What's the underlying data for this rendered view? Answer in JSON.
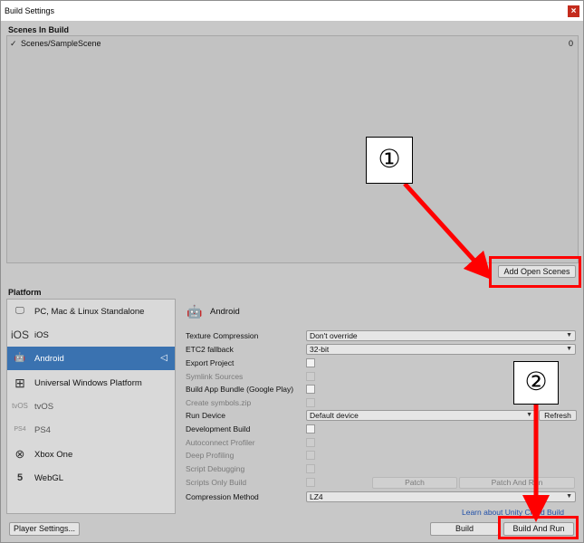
{
  "window": {
    "title": "Build Settings",
    "close_glyph": "×"
  },
  "scenes": {
    "header": "Scenes In Build",
    "items": [
      {
        "checked": true,
        "check_glyph": "✓",
        "name": "Scenes/SampleScene",
        "index": "0"
      }
    ],
    "add_open_scenes_label": "Add Open Scenes"
  },
  "platform": {
    "header": "Platform",
    "items": [
      {
        "label": "PC, Mac & Linux Standalone",
        "icon": "monitor-icon",
        "glyph": "🖵",
        "selected": false,
        "dim": false
      },
      {
        "label": "iOS",
        "icon": "ios-icon",
        "glyph": "iOS",
        "selected": false,
        "dim": false
      },
      {
        "label": "Android",
        "icon": "android-icon",
        "glyph": "🤖",
        "selected": true,
        "dim": false
      },
      {
        "label": "Universal Windows Platform",
        "icon": "windows-icon",
        "glyph": "⊞",
        "selected": false,
        "dim": false
      },
      {
        "label": "tvOS",
        "icon": "tvos-icon",
        "glyph": "tvOS",
        "selected": false,
        "dim": true
      },
      {
        "label": "PS4",
        "icon": "ps4-icon",
        "glyph": "PS4",
        "selected": false,
        "dim": true
      },
      {
        "label": "Xbox One",
        "icon": "xbox-icon",
        "glyph": "⊗",
        "selected": false,
        "dim": false
      },
      {
        "label": "WebGL",
        "icon": "html5-icon",
        "glyph": "5",
        "selected": false,
        "dim": false
      }
    ],
    "unity_badge_glyph": "◁"
  },
  "settings": {
    "title": "Android",
    "title_icon_glyph": "🤖",
    "texture_compression": {
      "label": "Texture Compression",
      "value": "Don't override"
    },
    "etc2_fallback": {
      "label": "ETC2 fallback",
      "value": "32-bit"
    },
    "export_project": {
      "label": "Export Project"
    },
    "symlink_sources": {
      "label": "Symlink Sources"
    },
    "build_app_bundle": {
      "label": "Build App Bundle (Google Play)"
    },
    "create_symbols": {
      "label": "Create symbols.zip"
    },
    "run_device": {
      "label": "Run Device",
      "value": "Default device",
      "refresh_label": "Refresh"
    },
    "development_build": {
      "label": "Development Build"
    },
    "autoconnect_profiler": {
      "label": "Autoconnect Profiler"
    },
    "deep_profiling": {
      "label": "Deep Profiling"
    },
    "script_debugging": {
      "label": "Script Debugging"
    },
    "scripts_only_build": {
      "label": "Scripts Only Build",
      "patch_label": "Patch",
      "patch_and_run_label": "Patch And Run"
    },
    "compression_method": {
      "label": "Compression Method",
      "value": "LZ4"
    },
    "dropdown_arrow": "▼"
  },
  "footer": {
    "cloud_build_link": "Learn about Unity Cloud Build",
    "player_settings_label": "Player Settings...",
    "build_label": "Build",
    "build_and_run_label": "Build And Run"
  },
  "annotations": {
    "step1": "①",
    "step2": "②",
    "color": "#ff0000"
  }
}
